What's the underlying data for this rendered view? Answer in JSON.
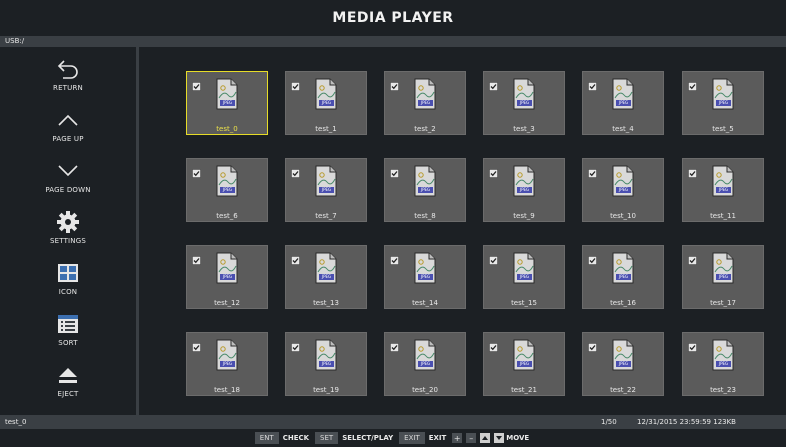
{
  "header": {
    "title": "MEDIA PLAYER"
  },
  "path": {
    "text": "USB:/"
  },
  "sidebar": {
    "items": [
      {
        "label": "RETURN",
        "icon": "return-icon"
      },
      {
        "label": "PAGE UP",
        "icon": "chevron-up-icon"
      },
      {
        "label": "PAGE DOWN",
        "icon": "chevron-down-icon"
      },
      {
        "label": "SETTINGS",
        "icon": "gear-icon"
      },
      {
        "label": "ICON",
        "icon": "grid-view-icon"
      },
      {
        "label": "SORT",
        "icon": "sort-list-icon"
      },
      {
        "label": "EJECT",
        "icon": "eject-icon"
      }
    ]
  },
  "files": [
    {
      "name": "test_0",
      "checked": true,
      "selected": true,
      "type": "JPEG"
    },
    {
      "name": "test_1",
      "checked": true,
      "type": "JPEG"
    },
    {
      "name": "test_2",
      "checked": true,
      "type": "JPEG"
    },
    {
      "name": "test_3",
      "checked": true,
      "type": "JPEG"
    },
    {
      "name": "test_4",
      "checked": true,
      "type": "JPEG"
    },
    {
      "name": "test_5",
      "checked": true,
      "type": "JPEG"
    },
    {
      "name": "test_6",
      "checked": true,
      "type": "JPEG"
    },
    {
      "name": "test_7",
      "checked": true,
      "type": "JPEG"
    },
    {
      "name": "test_8",
      "checked": true,
      "type": "JPEG"
    },
    {
      "name": "test_9",
      "checked": true,
      "type": "JPEG"
    },
    {
      "name": "test_10",
      "checked": true,
      "type": "JPEG"
    },
    {
      "name": "test_11",
      "checked": true,
      "type": "JPEG"
    },
    {
      "name": "test_12",
      "checked": true,
      "type": "JPEG"
    },
    {
      "name": "test_13",
      "checked": true,
      "type": "JPEG"
    },
    {
      "name": "test_14",
      "checked": true,
      "type": "JPEG"
    },
    {
      "name": "test_15",
      "checked": true,
      "type": "JPEG"
    },
    {
      "name": "test_16",
      "checked": true,
      "type": "JPEG"
    },
    {
      "name": "test_17",
      "checked": true,
      "type": "JPEG"
    },
    {
      "name": "test_18",
      "checked": true,
      "type": "JPEG"
    },
    {
      "name": "test_19",
      "checked": true,
      "type": "JPEG"
    },
    {
      "name": "test_20",
      "checked": true,
      "type": "JPEG"
    },
    {
      "name": "test_21",
      "checked": true,
      "type": "JPEG"
    },
    {
      "name": "test_22",
      "checked": true,
      "type": "JPEG"
    },
    {
      "name": "test_23",
      "checked": true,
      "type": "JPEG"
    }
  ],
  "status": {
    "selected_file": "test_0",
    "page": "1/50",
    "info": "12/31/2015 23:59:59 123KB"
  },
  "help": {
    "ent_key": "ENT",
    "ent_action": "CHECK",
    "set_key": "SET",
    "set_action": "SELECT/PLAY",
    "exit_key": "EXIT",
    "exit_action": "EXIT",
    "plus": "+",
    "minus": "–",
    "move_action": "MOVE"
  },
  "colors": {
    "selection": "#e6dc28",
    "tile": "#5b5b5b",
    "background": "#1c2024",
    "bar": "#3a3f44"
  }
}
